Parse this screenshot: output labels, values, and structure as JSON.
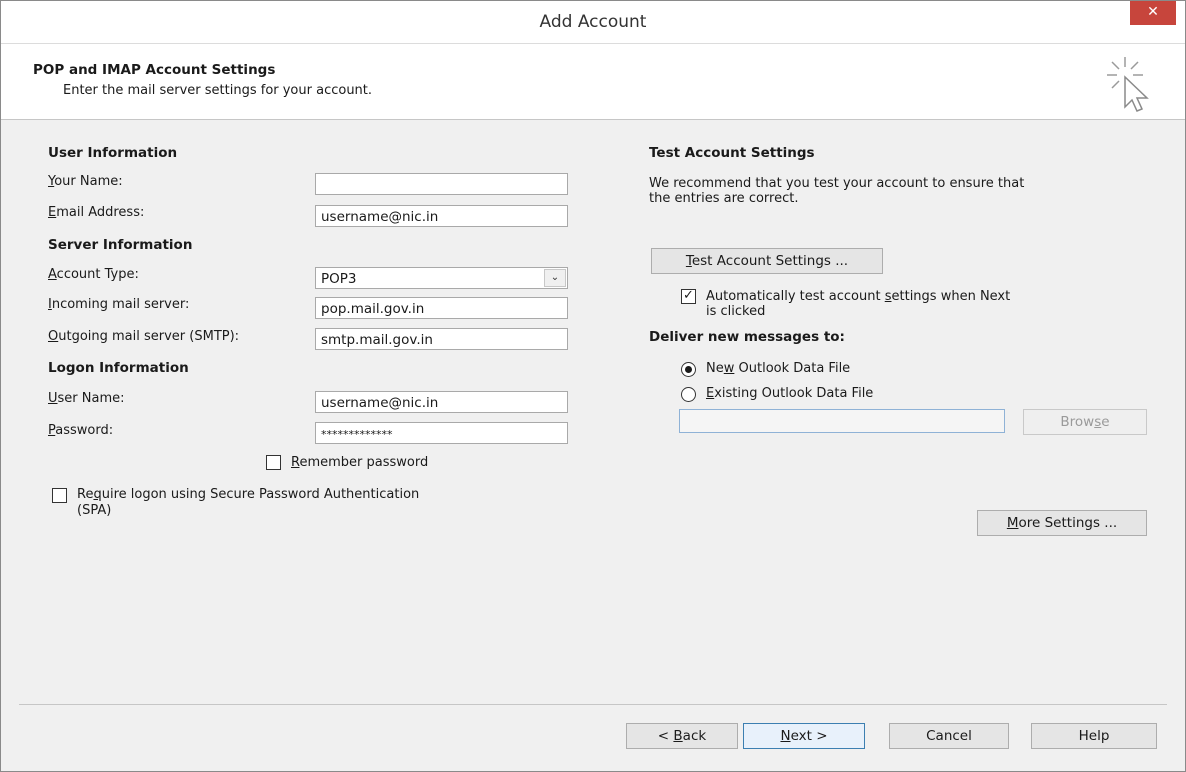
{
  "window": {
    "title": "Add Account",
    "close_label": "✕"
  },
  "header": {
    "title": "POP and IMAP Account Settings",
    "subtitle": "Enter the mail server settings for your account."
  },
  "user_info": {
    "heading": "User Information",
    "name_label_accel": "Y",
    "name_label_rest": "our Name:",
    "name_value": "",
    "email_label_accel": "E",
    "email_label_rest": "mail Address:",
    "email_value": "username@nic.in"
  },
  "server_info": {
    "heading": "Server Information",
    "account_type_label_accel": "A",
    "account_type_label_rest": "ccount Type:",
    "account_type_value": "POP3",
    "incoming_label_accel": "I",
    "incoming_label_rest": "ncoming mail server:",
    "incoming_value": "pop.mail.gov.in",
    "outgoing_label_accel": "O",
    "outgoing_label_rest": "utgoing mail server (SMTP):",
    "outgoing_value": "smtp.mail.gov.in"
  },
  "logon_info": {
    "heading": "Logon Information",
    "username_label_accel": "U",
    "username_label_rest": "ser Name:",
    "username_value": "username@nic.in",
    "password_label_accel": "P",
    "password_label_rest": "assword:",
    "password_value": "*************",
    "remember_accel": "R",
    "remember_rest": "emember password",
    "remember_checked": false,
    "spa_pre": "Re",
    "spa_accel": "q",
    "spa_rest": "uire logon using Secure Password Authentication",
    "spa_line2": "(SPA)",
    "spa_checked": false
  },
  "test": {
    "heading": "Test Account Settings",
    "desc_line1": "We recommend that you test your account to ensure that",
    "desc_line2": "the entries are correct.",
    "button_accel": "T",
    "button_rest": "est Account Settings ...",
    "auto_pre": "Automatically test account ",
    "auto_accel": "s",
    "auto_rest": "ettings when Next",
    "auto_line2": "is clicked",
    "auto_checked": true
  },
  "deliver": {
    "heading": "Deliver new messages to:",
    "new_pre": "Ne",
    "new_accel": "w",
    "new_rest": " Outlook Data File",
    "existing_accel": "E",
    "existing_rest": "xisting Outlook Data File",
    "selected": "new",
    "path_value": "",
    "browse_pre": "Brow",
    "browse_accel": "s",
    "browse_rest": "e"
  },
  "more_settings": {
    "accel": "M",
    "rest": "ore Settings ..."
  },
  "footer": {
    "back_pre": "< ",
    "back_accel": "B",
    "back_rest": "ack",
    "next_accel": "N",
    "next_rest": "ext >",
    "cancel_label": "Cancel",
    "help_label": "Help"
  }
}
